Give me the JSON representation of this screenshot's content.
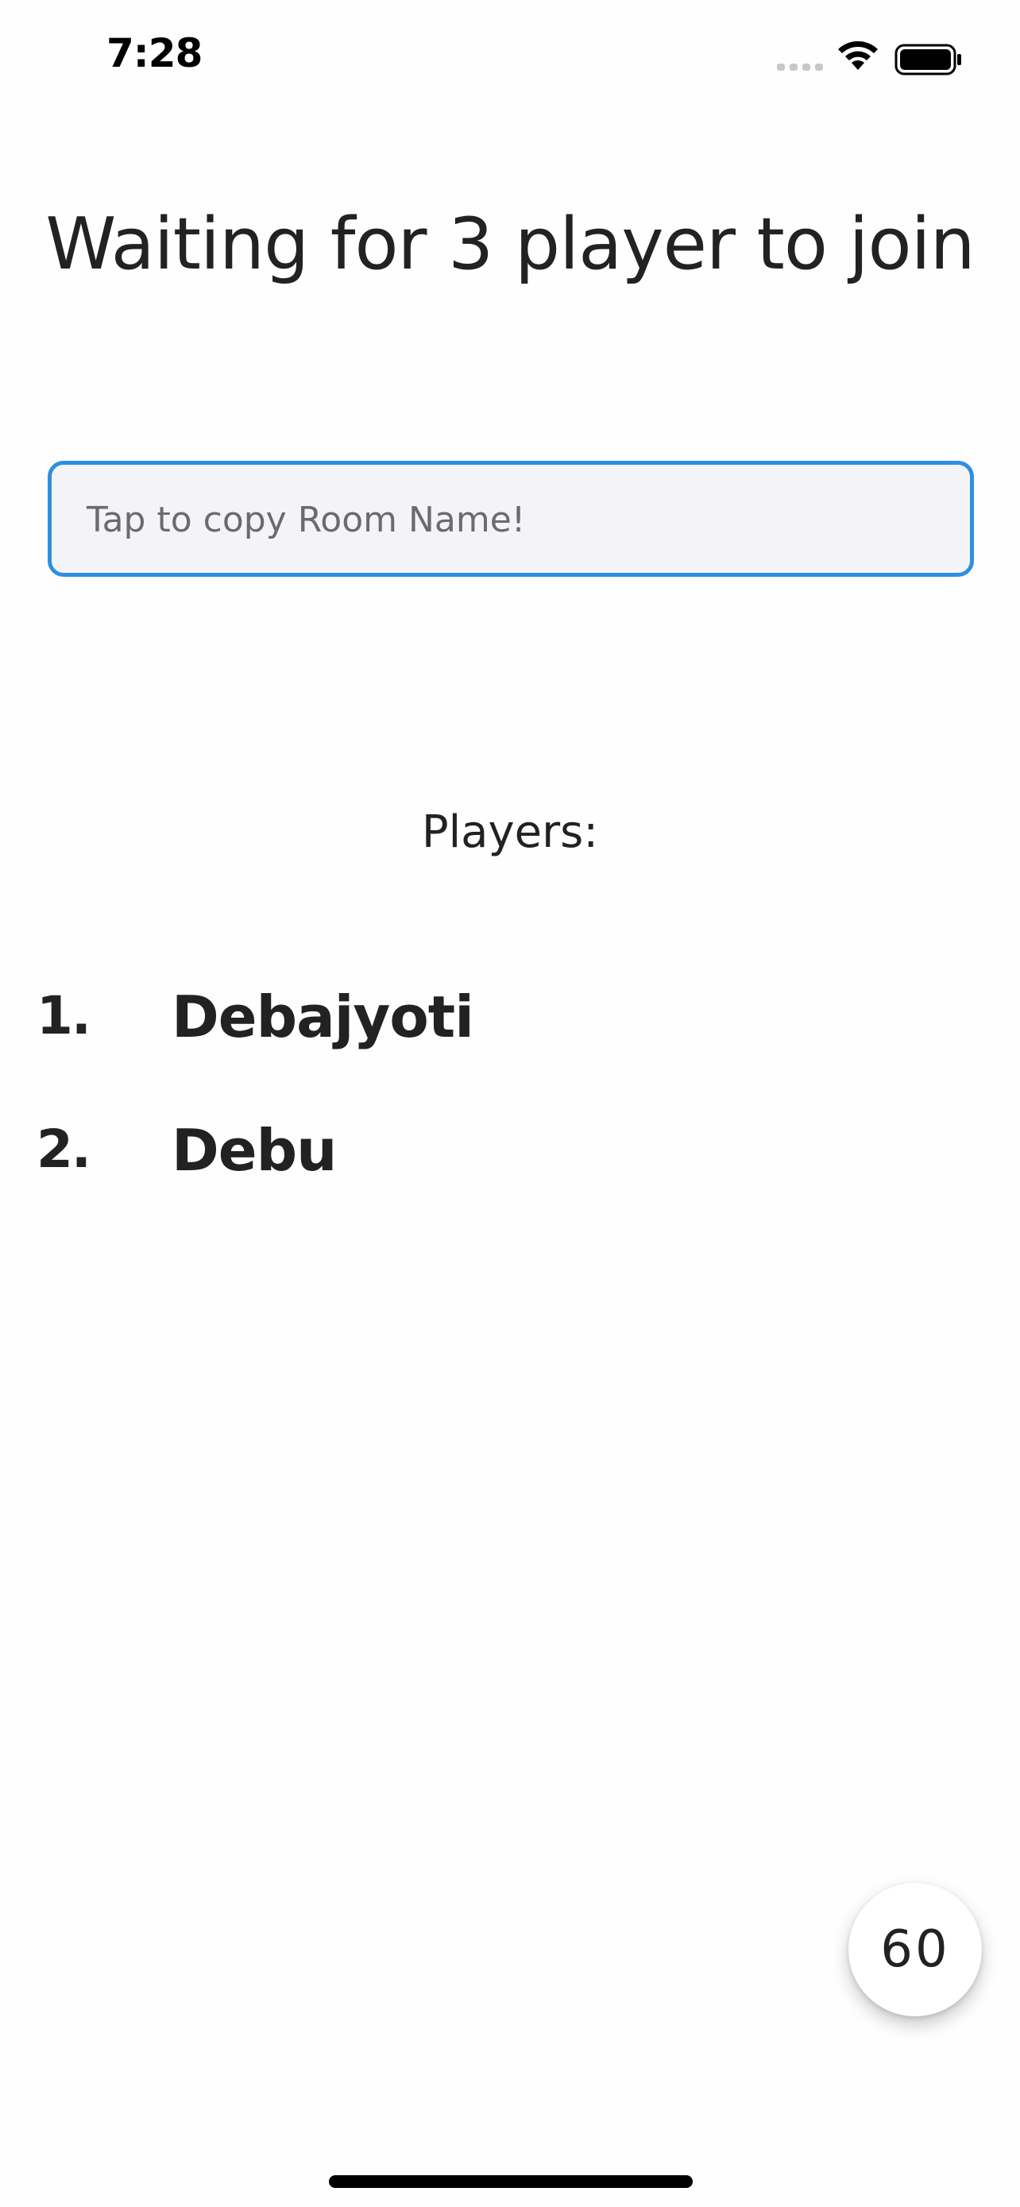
{
  "status_bar": {
    "time": "7:28",
    "icons": [
      "cellular-signal-icon",
      "wifi-icon",
      "battery-icon"
    ]
  },
  "screen": {
    "title": "Waiting for 3 player to join",
    "room_field": {
      "placeholder": "Tap to copy Room Name!"
    },
    "players_heading": "Players:",
    "players": [
      {
        "number": "1.",
        "name": "Debajyoti"
      },
      {
        "number": "2.",
        "name": "Debu"
      }
    ],
    "countdown": "60"
  },
  "colors": {
    "accent": "#2d8fe0",
    "field_background": "#f4f4f8",
    "text": "#222222",
    "placeholder_text": "#6b6b6b",
    "background": "#fefefe"
  }
}
